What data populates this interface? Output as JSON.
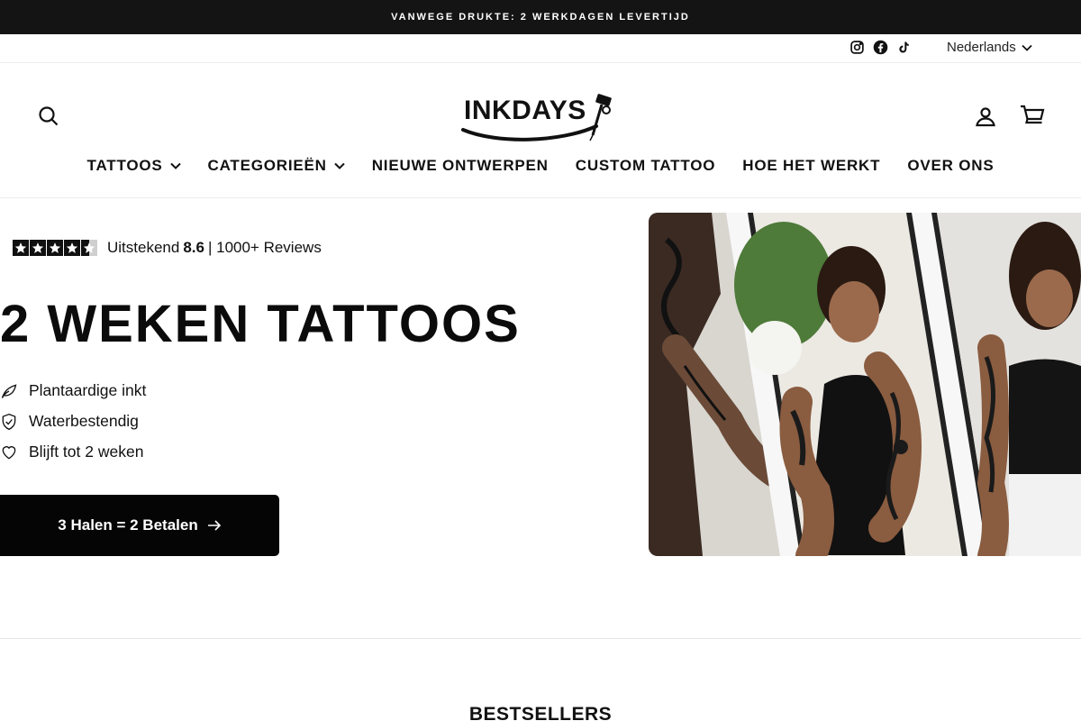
{
  "announcement": "VANWEGE DRUKTE: 2 WERKDAGEN LEVERTIJD",
  "utility": {
    "social_icons": [
      "instagram-icon",
      "facebook-icon",
      "tiktok-icon"
    ],
    "language": "Nederlands"
  },
  "header": {
    "logo_text": "INKDAYS",
    "icons": [
      "search-icon",
      "account-icon",
      "cart-icon"
    ]
  },
  "nav": [
    {
      "label": "TATTOOS",
      "dropdown": true
    },
    {
      "label": "CATEGORIEËN",
      "dropdown": true
    },
    {
      "label": "NIEUWE ONTWERPEN",
      "dropdown": false
    },
    {
      "label": "CUSTOM TATTOO",
      "dropdown": false
    },
    {
      "label": "HOE HET WERKT",
      "dropdown": false
    },
    {
      "label": "OVER ONS",
      "dropdown": false
    }
  ],
  "hero": {
    "rating": {
      "stars": 4.5,
      "prefix": "Uitstekend",
      "score": "8.6",
      "suffix": "| 1000+ Reviews"
    },
    "title": "2 WEKEN TATTOOS",
    "features": [
      {
        "icon": "leaf-icon",
        "label": "Plantaardige inkt"
      },
      {
        "icon": "shield-check-icon",
        "label": "Waterbestendig"
      },
      {
        "icon": "heart-icon",
        "label": "Blijft tot 2 weken"
      }
    ],
    "cta_label": "3 Halen = 2 Betalen"
  },
  "section_title": "BESTSELLERS",
  "colors": {
    "announcement_bg": "#141414",
    "cta_bg": "#050505",
    "text": "#111111"
  }
}
